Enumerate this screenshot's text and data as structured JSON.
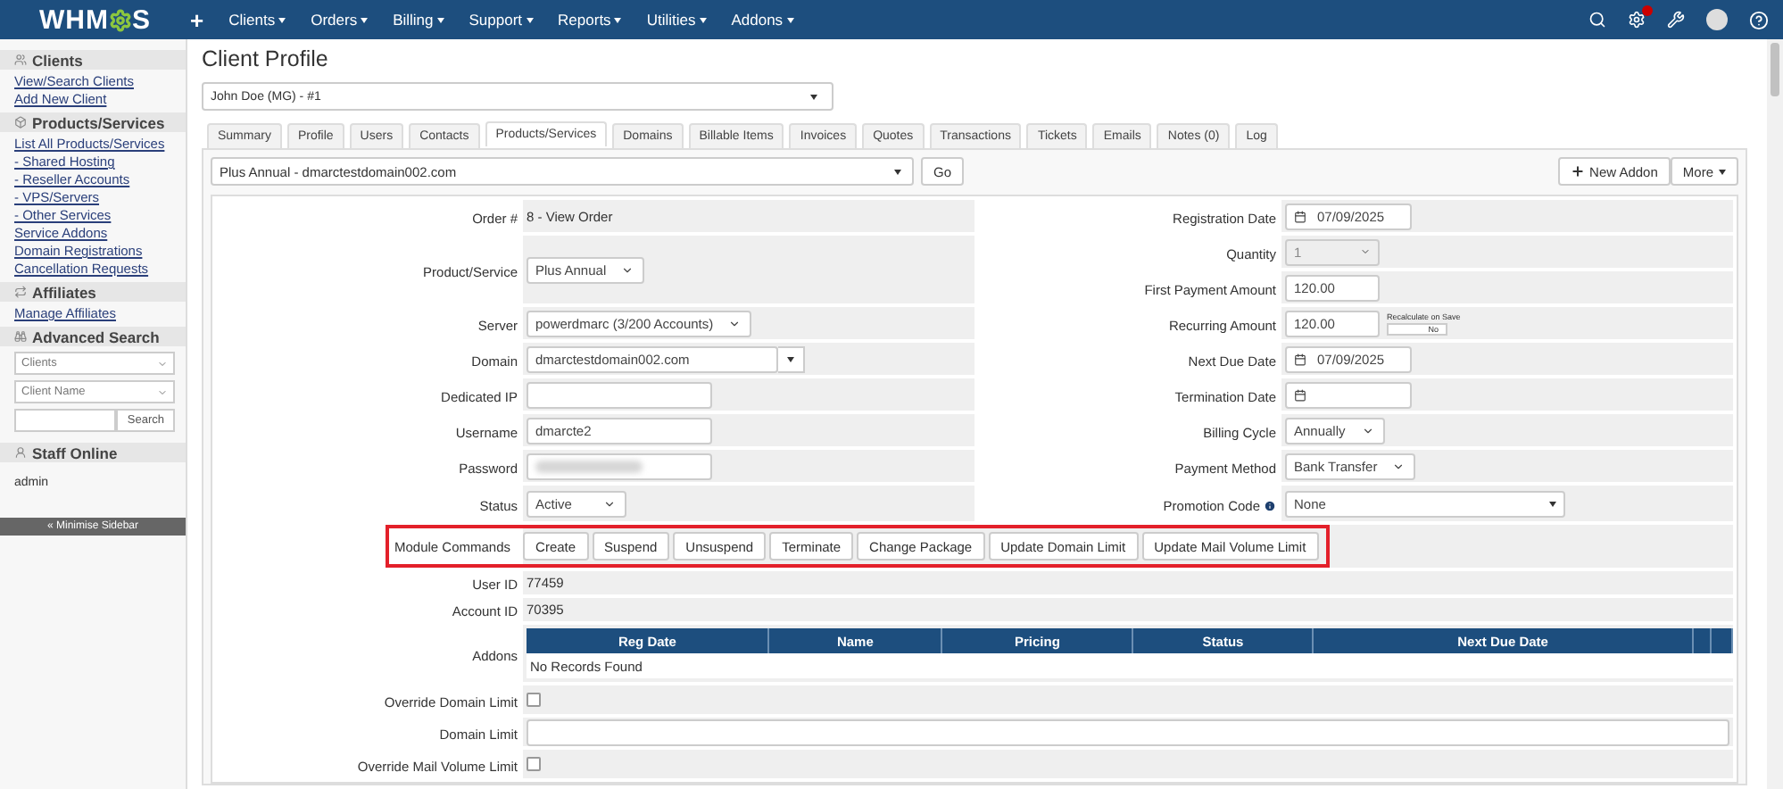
{
  "navbar": {
    "logo": {
      "before_mark": "WHM",
      "after_mark": "S"
    },
    "add": "+",
    "menu": [
      "Clients",
      "Orders",
      "Billing",
      "Support",
      "Reports",
      "Utilities",
      "Addons"
    ]
  },
  "sidebar": {
    "sections": [
      {
        "title": "Clients",
        "kind": "links",
        "items": [
          "View/Search Clients",
          "Add New Client"
        ]
      },
      {
        "title": "Products/Services",
        "kind": "links",
        "items": [
          "List All Products/Services",
          "- Shared Hosting",
          "- Reseller Accounts",
          "- VPS/Servers",
          "- Other Services",
          "Service Addons",
          "Domain Registrations",
          "Cancellation Requests"
        ]
      },
      {
        "title": "Affiliates",
        "kind": "links",
        "items": [
          "Manage Affiliates"
        ]
      },
      {
        "title": "Advanced Search",
        "kind": "search",
        "selects": [
          "Clients",
          "Client Name"
        ],
        "button": "Search"
      },
      {
        "title": "Staff Online",
        "kind": "text",
        "items": [
          "admin"
        ]
      }
    ],
    "minimise": "« Minimise Sidebar"
  },
  "page": {
    "title": "Client Profile",
    "client": "John Doe (MG) - #1"
  },
  "tabs": [
    {
      "label": "Summary",
      "selected": false
    },
    {
      "label": "Profile",
      "selected": false
    },
    {
      "label": "Users",
      "selected": false
    },
    {
      "label": "Contacts",
      "selected": false
    },
    {
      "label": "Products/Services",
      "selected": true
    },
    {
      "label": "Domains",
      "selected": false
    },
    {
      "label": "Billable Items",
      "selected": false
    },
    {
      "label": "Invoices",
      "selected": false
    },
    {
      "label": "Quotes",
      "selected": false
    },
    {
      "label": "Transactions",
      "selected": false
    },
    {
      "label": "Tickets",
      "selected": false
    },
    {
      "label": "Emails",
      "selected": false
    },
    {
      "label": "Notes (0)",
      "selected": false
    },
    {
      "label": "Log",
      "selected": false
    }
  ],
  "service_bar": {
    "service": "Plus Annual - dmarctestdomain002.com",
    "go": "Go",
    "new_addon": "New Addon",
    "more": "More"
  },
  "rows": [
    {
      "left": {
        "label": "Order #",
        "kind": "static",
        "value": "8 - View Order"
      },
      "right": [
        {
          "label": "Registration Date",
          "kind": "date",
          "value": "07/09/2025"
        }
      ]
    },
    {
      "left": {
        "label": "Product/Service",
        "kind": "select",
        "value": "Plus Annual"
      },
      "right": [
        {
          "label": "Quantity",
          "kind": "spinner",
          "value": "1",
          "disabled": true
        },
        {
          "label": "First Payment Amount",
          "kind": "amount",
          "value": "120.00"
        }
      ]
    },
    {
      "left": {
        "label": "Server",
        "kind": "select",
        "value": "powerdmarc (3/200 Accounts)"
      },
      "right": [
        {
          "label": "Recurring Amount",
          "kind": "amount",
          "value": "120.00",
          "recalculate": {
            "label": "Recalculate on Save",
            "toggle": "No",
            "on": false
          }
        }
      ]
    },
    {
      "left": {
        "label": "Domain",
        "kind": "combo",
        "value": "dmarctestdomain002.com"
      },
      "right": [
        {
          "label": "Next Due Date",
          "kind": "date",
          "value": "07/09/2025"
        }
      ]
    },
    {
      "left": {
        "label": "Dedicated IP",
        "kind": "input"
      },
      "right": [
        {
          "label": "Termination Date",
          "kind": "date"
        }
      ]
    },
    {
      "left": {
        "label": "Username",
        "kind": "input",
        "value": "dmarcte2"
      },
      "right": [
        {
          "label": "Billing Cycle",
          "kind": "select",
          "value": "Annually"
        }
      ]
    },
    {
      "left": {
        "label": "Password",
        "kind": "password"
      },
      "right": [
        {
          "label": "Payment Method",
          "kind": "select",
          "value": "Bank Transfer"
        }
      ]
    },
    {
      "left": {
        "label": "Status",
        "kind": "select",
        "value": "Active"
      },
      "right": [
        {
          "label": "Promotion Code",
          "kind": "dropdown",
          "value": "None",
          "info": true
        }
      ]
    }
  ],
  "module_commands": {
    "label": "Module Commands",
    "buttons": [
      "Create",
      "Suspend",
      "Unsuspend",
      "Terminate",
      "Change Package",
      "Update Domain Limit",
      "Update Mail Volume Limit"
    ]
  },
  "details": [
    {
      "label": "User ID",
      "value": "77459"
    },
    {
      "label": "Account ID",
      "value": "70395"
    }
  ],
  "addons": {
    "label": "Addons",
    "columns": [
      "Reg Date",
      "Name",
      "Pricing",
      "Status",
      "Next Due Date"
    ],
    "empty": "No Records Found"
  },
  "limits": [
    {
      "label": "Override Domain Limit",
      "kind": "checkbox",
      "checked": false
    },
    {
      "label": "Domain Limit",
      "kind": "input"
    },
    {
      "label": "Override Mail Volume Limit",
      "kind": "checkbox",
      "checked": false
    }
  ]
}
